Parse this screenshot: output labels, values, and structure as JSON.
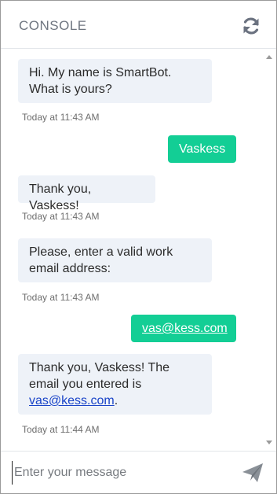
{
  "header": {
    "title": "CONSOLE",
    "refresh_icon": "refresh-icon"
  },
  "messages": [
    {
      "sender": "bot",
      "text": "Hi.  My name is SmartBot. What is yours?",
      "time": "Today at 11:43 AM"
    },
    {
      "sender": "user",
      "text": "Vaskess"
    },
    {
      "sender": "bot",
      "text": "Thank you, Vaskess!",
      "time": "Today at 11:43 AM"
    },
    {
      "sender": "bot",
      "text": "Please, enter a valid work email address:",
      "time": "Today at 11:43 AM"
    },
    {
      "sender": "user",
      "text": "vas@kess.com"
    },
    {
      "sender": "bot",
      "text_before": "Thank you, Vaskess! The email you entered is ",
      "link": "vas@kess.com",
      "text_after": ".",
      "time": "Today at 11:44 AM"
    }
  ],
  "composer": {
    "placeholder": "Enter your message",
    "send_icon": "send-icon"
  },
  "colors": {
    "accent": "#13ce95",
    "bot_bubble": "#eef2f8",
    "link": "#1a44c8"
  }
}
